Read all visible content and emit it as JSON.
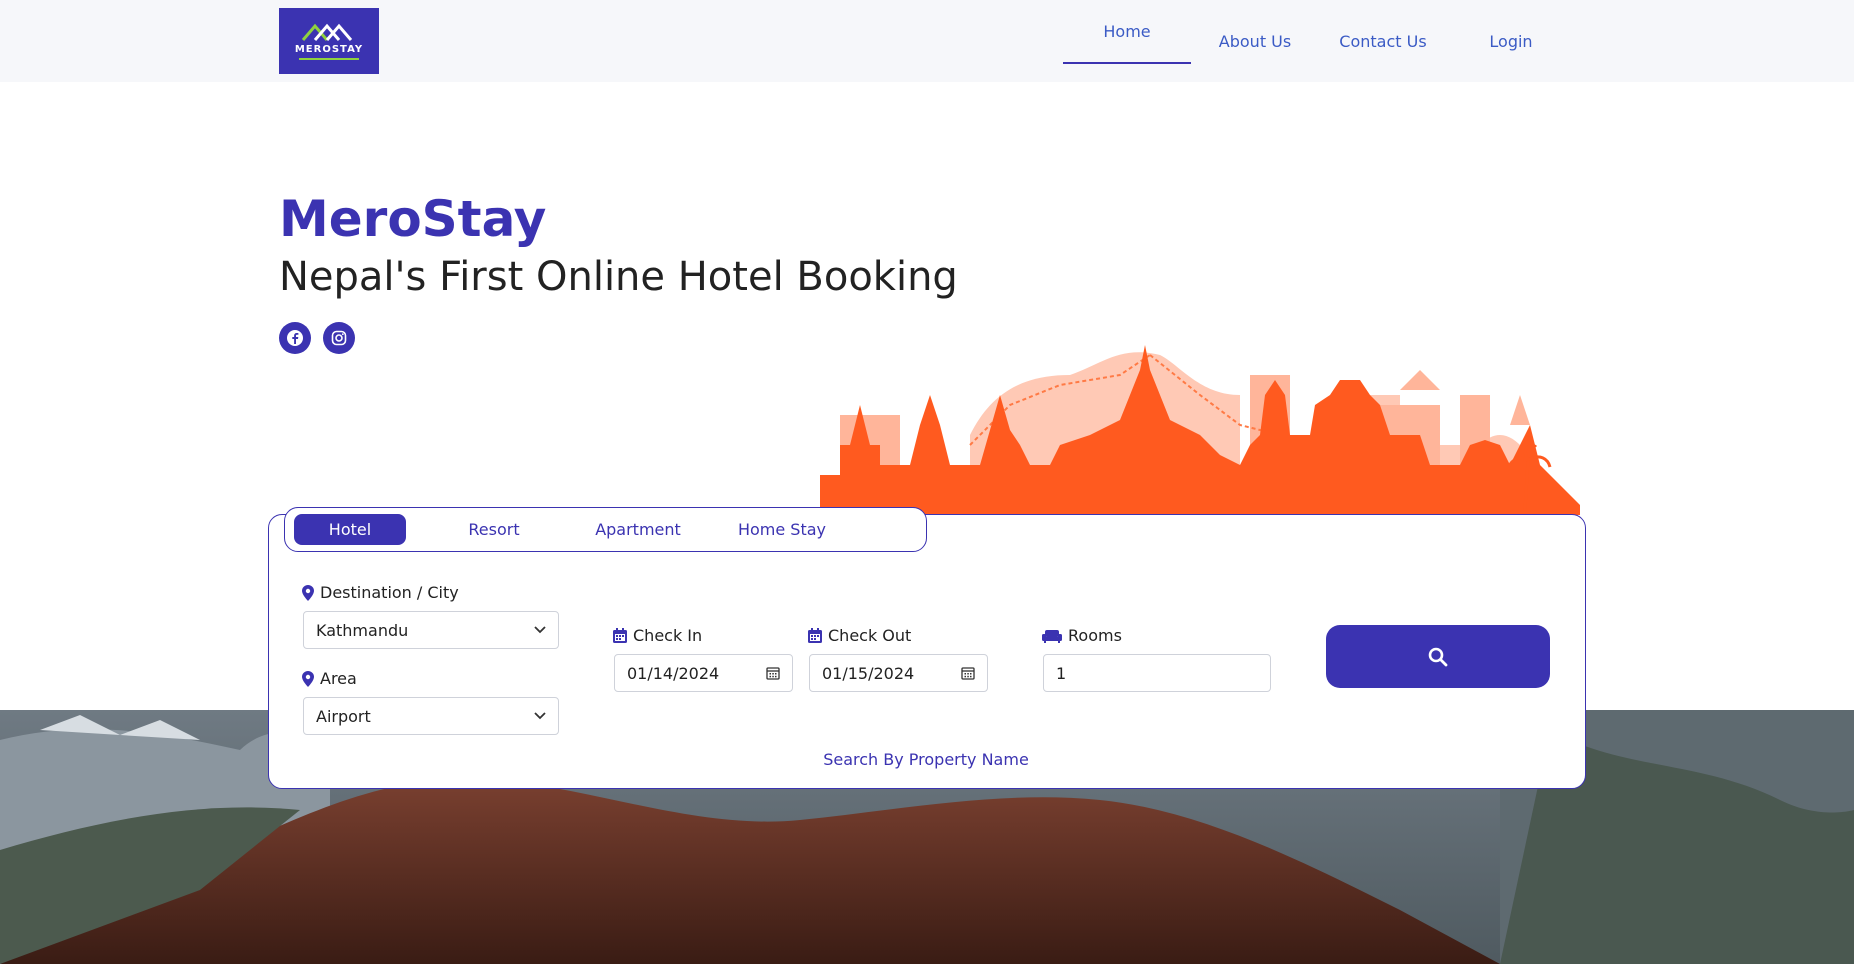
{
  "header": {
    "logo_text": "MEROSTAY",
    "nav": {
      "home": "Home",
      "about": "About Us",
      "contact": "Contact Us",
      "login": "Login"
    }
  },
  "hero": {
    "brand": "MeroStay",
    "tagline": "Nepal's First Online Hotel Booking"
  },
  "booking": {
    "tabs": {
      "hotel": "Hotel",
      "resort": "Resort",
      "apartment": "Apartment",
      "homestay": "Home Stay"
    },
    "destination_label": "Destination / City",
    "destination_value": "Kathmandu",
    "area_label": "Area",
    "area_value": "Airport",
    "checkin_label": "Check In",
    "checkin_value": "01/14/2024",
    "checkout_label": "Check Out",
    "checkout_value": "01/15/2024",
    "rooms_label": "Rooms",
    "rooms_value": "1",
    "search_by_name": "Search By Property Name"
  },
  "colors": {
    "brand": "#3b33b1",
    "skyline": "#ff5a1f",
    "skyline_light": "#ffb59a",
    "header_bg": "#f6f7fa"
  },
  "icons": [
    "facebook-icon",
    "instagram-icon",
    "map-pin-icon",
    "calendar-icon",
    "sofa-icon",
    "search-icon",
    "chevron-down-icon"
  ]
}
